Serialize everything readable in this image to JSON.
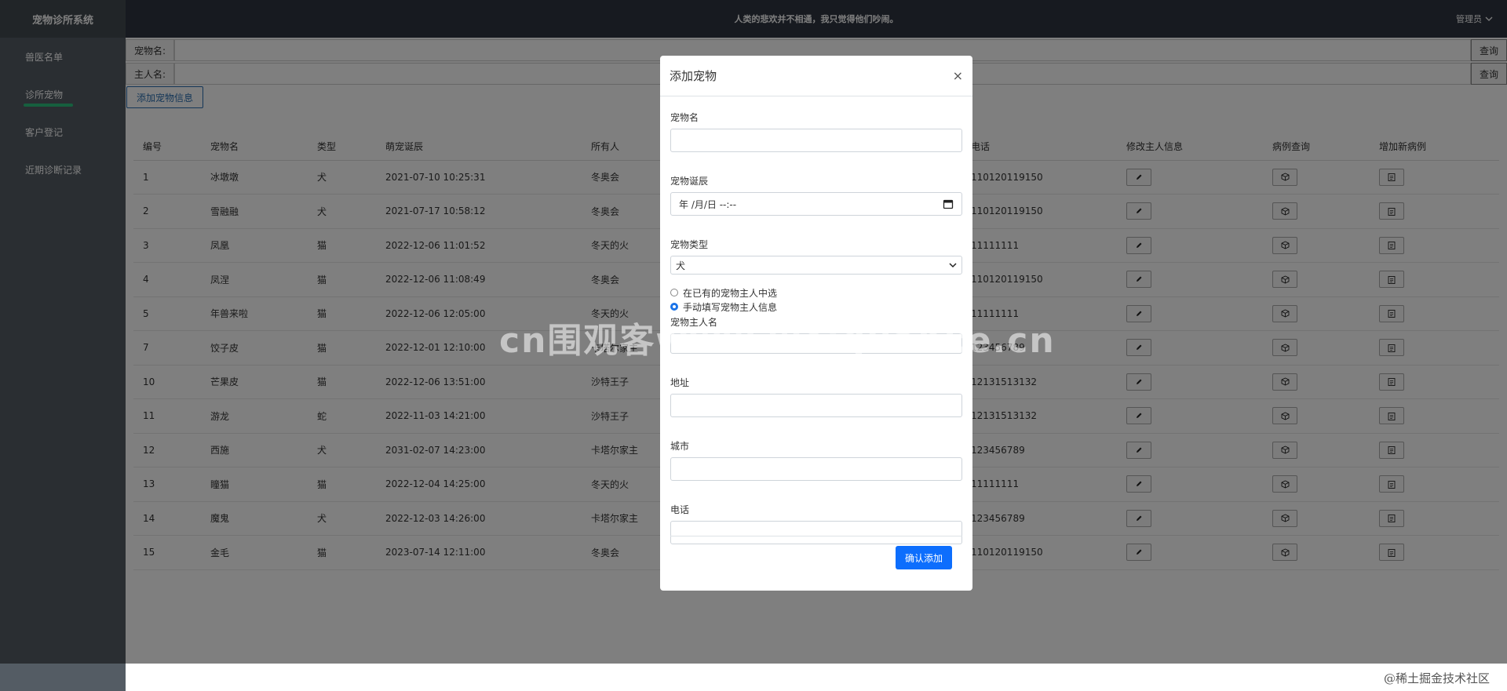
{
  "sidebar": {
    "brand": "宠物诊所系统",
    "items": [
      {
        "label": "兽医名单"
      },
      {
        "label": "诊所宠物"
      },
      {
        "label": "客户登记"
      },
      {
        "label": "近期诊断记录"
      }
    ],
    "active_index": 1,
    "accent_color": "#2cbf7d"
  },
  "topbar": {
    "motto": "人类的悲欢并不相通，我只觉得他们吵闹。",
    "admin_label": "管理员",
    "admin_icon": "chevron-down-icon"
  },
  "search": {
    "pet_label": "宠物名:",
    "owner_label": "主人名:",
    "query_label": "查询"
  },
  "add_pet_button": "添加宠物信息",
  "table": {
    "headers": [
      "编号",
      "宠物名",
      "类型",
      "萌宠诞辰",
      "所有人",
      "电话",
      "修改主人信息",
      "病例查询",
      "增加新病例"
    ],
    "rows": [
      {
        "id": "1",
        "name": "冰墩墩",
        "type": "犬",
        "birth": "2021-07-10 10:25:31",
        "owner": "冬奥会",
        "phone": "110120119150"
      },
      {
        "id": "2",
        "name": "雪融融",
        "type": "犬",
        "birth": "2021-07-17 10:58:12",
        "owner": "冬奥会",
        "phone": "110120119150"
      },
      {
        "id": "3",
        "name": "凤凰",
        "type": "猫",
        "birth": "2022-12-06 11:01:52",
        "owner": "冬天的火",
        "phone": "11111111"
      },
      {
        "id": "4",
        "name": "凤涅",
        "type": "猫",
        "birth": "2022-12-06 11:08:49",
        "owner": "冬奥会",
        "phone": "110120119150"
      },
      {
        "id": "5",
        "name": "年兽来啦",
        "type": "猫",
        "birth": "2022-12-06 12:05:00",
        "owner": "冬天的火",
        "phone": "11111111"
      },
      {
        "id": "7",
        "name": "饺子皮",
        "type": "猫",
        "birth": "2022-12-01 12:10:00",
        "owner": "卡塔尔家主",
        "phone": "123456789"
      },
      {
        "id": "10",
        "name": "芒果皮",
        "type": "猫",
        "birth": "2022-12-06 13:51:00",
        "owner": "沙特王子",
        "phone": "12131513132"
      },
      {
        "id": "11",
        "name": "游龙",
        "type": "蛇",
        "birth": "2022-11-03 14:21:00",
        "owner": "沙特王子",
        "phone": "12131513132"
      },
      {
        "id": "12",
        "name": "西施",
        "type": "犬",
        "birth": "2031-02-07 14:23:00",
        "owner": "卡塔尔家主",
        "phone": "123456789"
      },
      {
        "id": "13",
        "name": "瞳猫",
        "type": "猫",
        "birth": "2022-12-04 14:25:00",
        "owner": "冬天的火",
        "phone": "11111111"
      },
      {
        "id": "14",
        "name": "魔鬼",
        "type": "犬",
        "birth": "2022-12-03 14:26:00",
        "owner": "卡塔尔家主",
        "phone": "123456789"
      },
      {
        "id": "15",
        "name": "金毛",
        "type": "猫",
        "birth": "2023-07-14 12:11:00",
        "owner": "冬奥会",
        "phone": "110120119150"
      }
    ],
    "action_icons": [
      "pencil-icon",
      "cube-icon",
      "clipboard-icon"
    ]
  },
  "modal": {
    "title": "添加宠物",
    "close": "×",
    "pet_name_label": "宠物名",
    "pet_name_value": "",
    "birth_label": "宠物诞辰",
    "birth_placeholder": "年 /月/日 --:--",
    "type_label": "宠物类型",
    "type_selected": "犬",
    "radio_existing": "在已有的宠物主人中选",
    "radio_manual": "手动填写宠物主人信息",
    "owner_name_label": "宠物主人名",
    "address_label": "地址",
    "city_label": "城市",
    "phone_label": "电话",
    "confirm": "确认添加"
  },
  "watermarks": {
    "center": "cn围观客www.weiguanke.cn",
    "corner": "@稀土掘金技术社区"
  }
}
